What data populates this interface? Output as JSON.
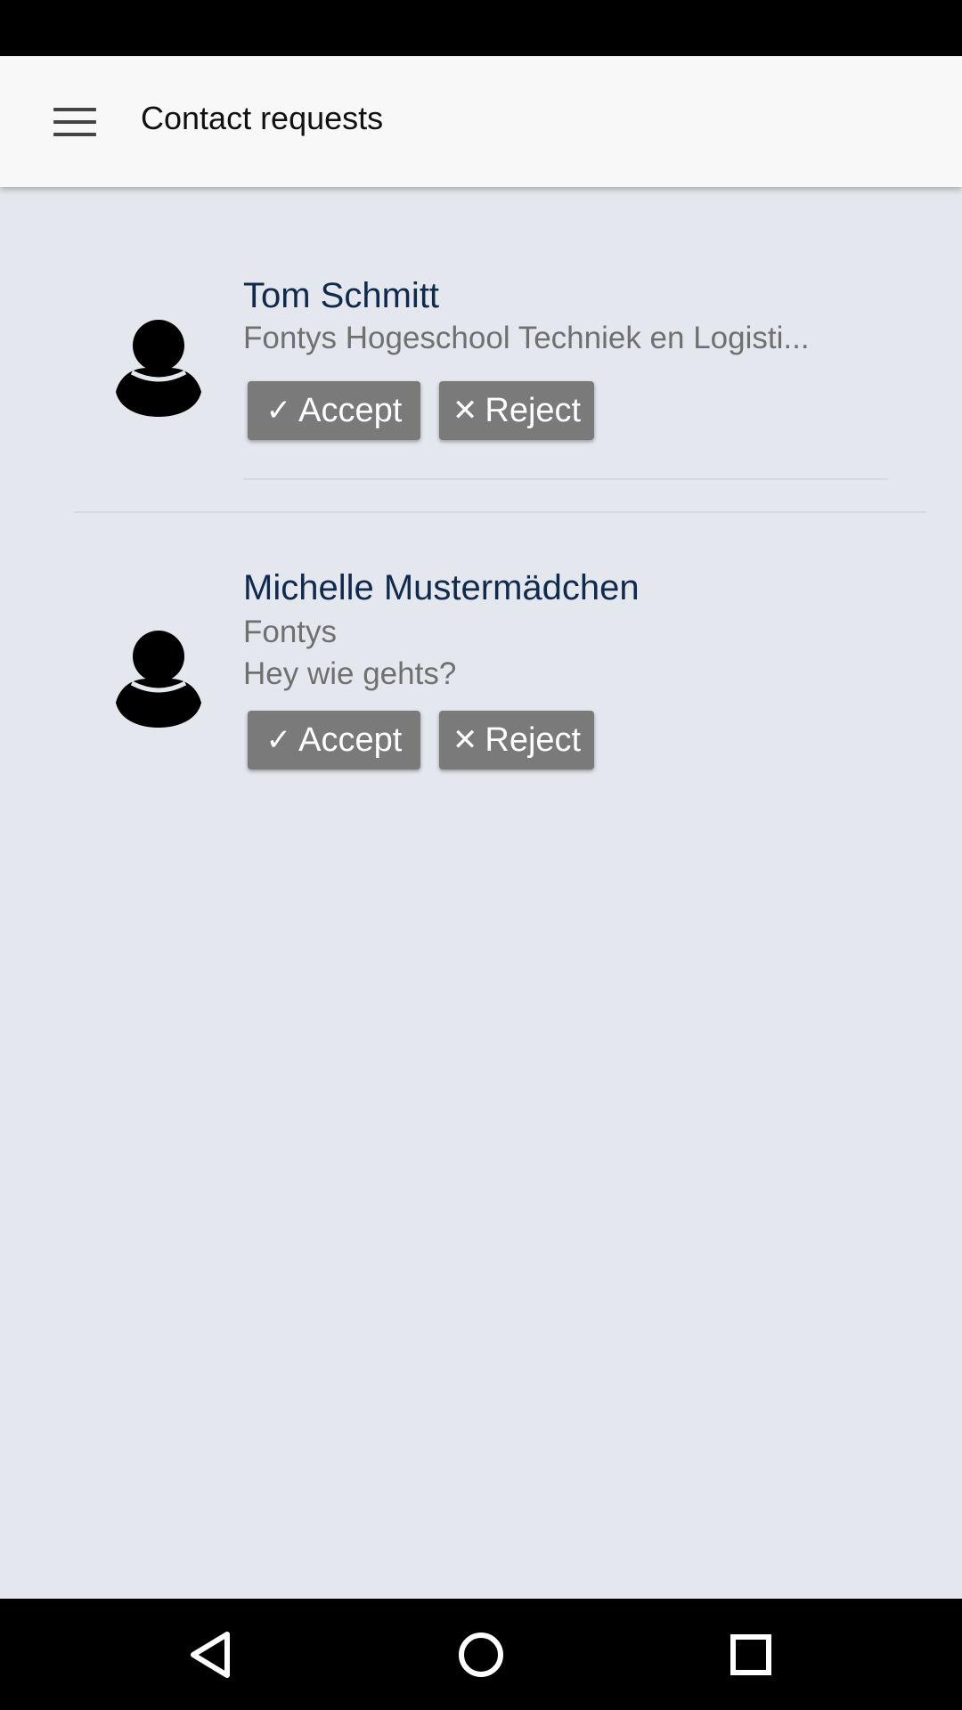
{
  "app_bar": {
    "title": "Contact requests",
    "menu_icon": "hamburger-menu-icon"
  },
  "requests": [
    {
      "name": "Tom Schmitt",
      "lines": [
        "Fontys Hogeschool Techniek en Logisti..."
      ],
      "accept_label": "Accept",
      "reject_label": "Reject"
    },
    {
      "name": "Michelle Mustermädchen",
      "lines": [
        "Fontys",
        "Hey wie gehts?"
      ],
      "accept_label": "Accept",
      "reject_label": "Reject"
    }
  ],
  "icons": {
    "avatar": "person-avatar-icon",
    "accept": "check-icon",
    "reject": "close-icon",
    "nav_back": "back-triangle-icon",
    "nav_home": "home-circle-icon",
    "nav_recents": "recents-square-icon"
  },
  "colors": {
    "background": "#e4e7ed",
    "app_bar": "#f8f8f8",
    "name": "#0f2a4d",
    "subtitle": "#707070",
    "button": "#7a7a7a"
  }
}
